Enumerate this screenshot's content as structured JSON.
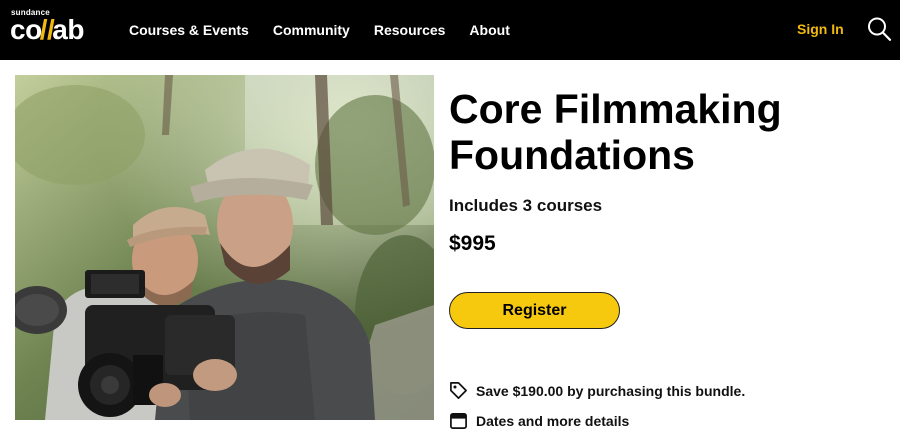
{
  "header": {
    "logo_small": "sundance",
    "logo_part1": "co",
    "logo_slash": "//",
    "logo_part2": "ab",
    "nav": [
      {
        "label": "Courses & Events"
      },
      {
        "label": "Community"
      },
      {
        "label": "Resources"
      },
      {
        "label": "About"
      }
    ],
    "sign_in_label": "Sign In",
    "search_icon": "search-icon"
  },
  "hero": {
    "image": "two-filmmakers-with-camera-in-woods"
  },
  "product": {
    "title": "Core Filmmaking Foundations",
    "includes": "Includes 3 courses",
    "price": "$995",
    "register_label": "Register",
    "perks": [
      {
        "icon": "tag-icon",
        "text": "Save $190.00 by purchasing this bundle."
      },
      {
        "icon": "calendar-icon",
        "text": "Dates and more details"
      }
    ]
  },
  "colors": {
    "header_bg": "#000000",
    "accent_yellow": "#f6c90e",
    "sign_in_yellow": "#f2b90f",
    "text": "#000000"
  }
}
